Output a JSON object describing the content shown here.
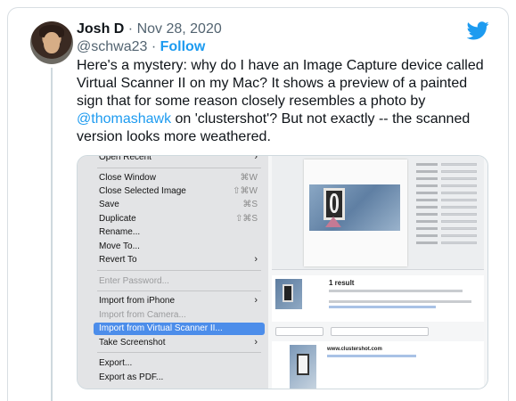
{
  "tweet": {
    "author_name": "Josh D",
    "date": " · Nov 28, 2020",
    "handle": "@schwa23",
    "separator": " · ",
    "follow_label": "Follow",
    "text_part1": "Here's a mystery: why do I have an Image Capture device called Virtual Scanner II on my Mac? It shows a preview of a painted sign that for some reason closely resembles a photo by ",
    "mention": "@thomashawk",
    "text_part2": " on 'clustershot'? But not exactly -- the scanned version looks more weathered."
  },
  "menu": {
    "items": [
      {
        "label": "Open Recent",
        "shortcut": "",
        "arrow": "›"
      },
      {
        "label": "Close Window",
        "shortcut": "⌘W"
      },
      {
        "label": "Close Selected Image",
        "shortcut": "⇧⌘W"
      },
      {
        "label": "Save",
        "shortcut": "⌘S"
      },
      {
        "label": "Duplicate",
        "shortcut": "⇧⌘S"
      },
      {
        "label": "Rename..."
      },
      {
        "label": "Move To..."
      },
      {
        "label": "Revert To",
        "arrow": "›"
      },
      {
        "label": "Enter Password..."
      },
      {
        "label": "Import from iPhone",
        "arrow": "›"
      },
      {
        "label": "Import from Camera..."
      },
      {
        "label": "Import from Virtual Scanner II..."
      },
      {
        "label": "Take Screenshot",
        "arrow": "›"
      },
      {
        "label": "Export..."
      },
      {
        "label": "Export as PDF..."
      }
    ]
  },
  "search_result": {
    "count_label": "1 result",
    "site": "www.clustershot.com"
  },
  "colors": {
    "accent": "#1d9bf0",
    "menu_highlight": "#4c8dea"
  },
  "icons": {
    "brand": "twitter-bird-icon"
  }
}
